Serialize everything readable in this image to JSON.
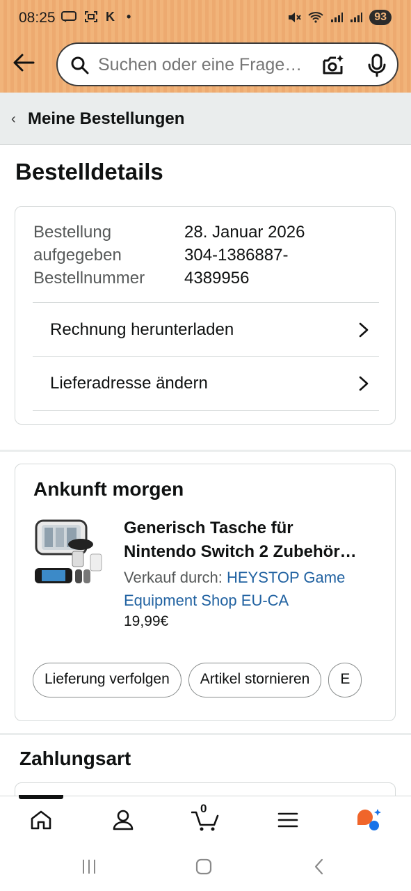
{
  "status_bar": {
    "time": "08:25",
    "left_icons": "K",
    "battery": "93"
  },
  "search": {
    "placeholder": "Suchen oder eine Frage…"
  },
  "breadcrumb": {
    "label": "Meine Bestellungen"
  },
  "page": {
    "title": "Bestelldetails"
  },
  "order": {
    "placed_label_line1": "Bestellung",
    "placed_label_line2": "aufgegeben",
    "number_label": "Bestellnummer",
    "placed_date": "28. Januar 2026",
    "number_line1": "304-1386887-",
    "number_line2": "4389956",
    "actions": [
      {
        "label": "Rechnung herunterladen"
      },
      {
        "label": "Lieferadresse ändern"
      }
    ]
  },
  "shipment": {
    "arrival": "Ankunft morgen",
    "product_title_line1": "Generisch Tasche für",
    "product_title_line2": "Nintendo Switch 2 Zubehör…",
    "seller_prefix": "Verkauf durch: ",
    "seller_name_line1": "HEYSTOP Game",
    "seller_name_line2": "Equipment Shop EU-CA",
    "price": "19,99€",
    "buttons": [
      {
        "label": "Lieferung verfolgen"
      },
      {
        "label": "Artikel stornieren"
      },
      {
        "label": "E"
      }
    ]
  },
  "payment": {
    "title": "Zahlungsart"
  },
  "bottom_nav": {
    "cart_count": "0",
    "items": [
      "home-icon",
      "account-icon",
      "cart-icon",
      "menu-icon",
      "rufus-assistant-icon"
    ]
  },
  "colors": {
    "header_bg": "#F1B47A",
    "link": "#2162A1",
    "text": "#0F1111",
    "muted": "#565959",
    "divider": "#EAEDED"
  }
}
